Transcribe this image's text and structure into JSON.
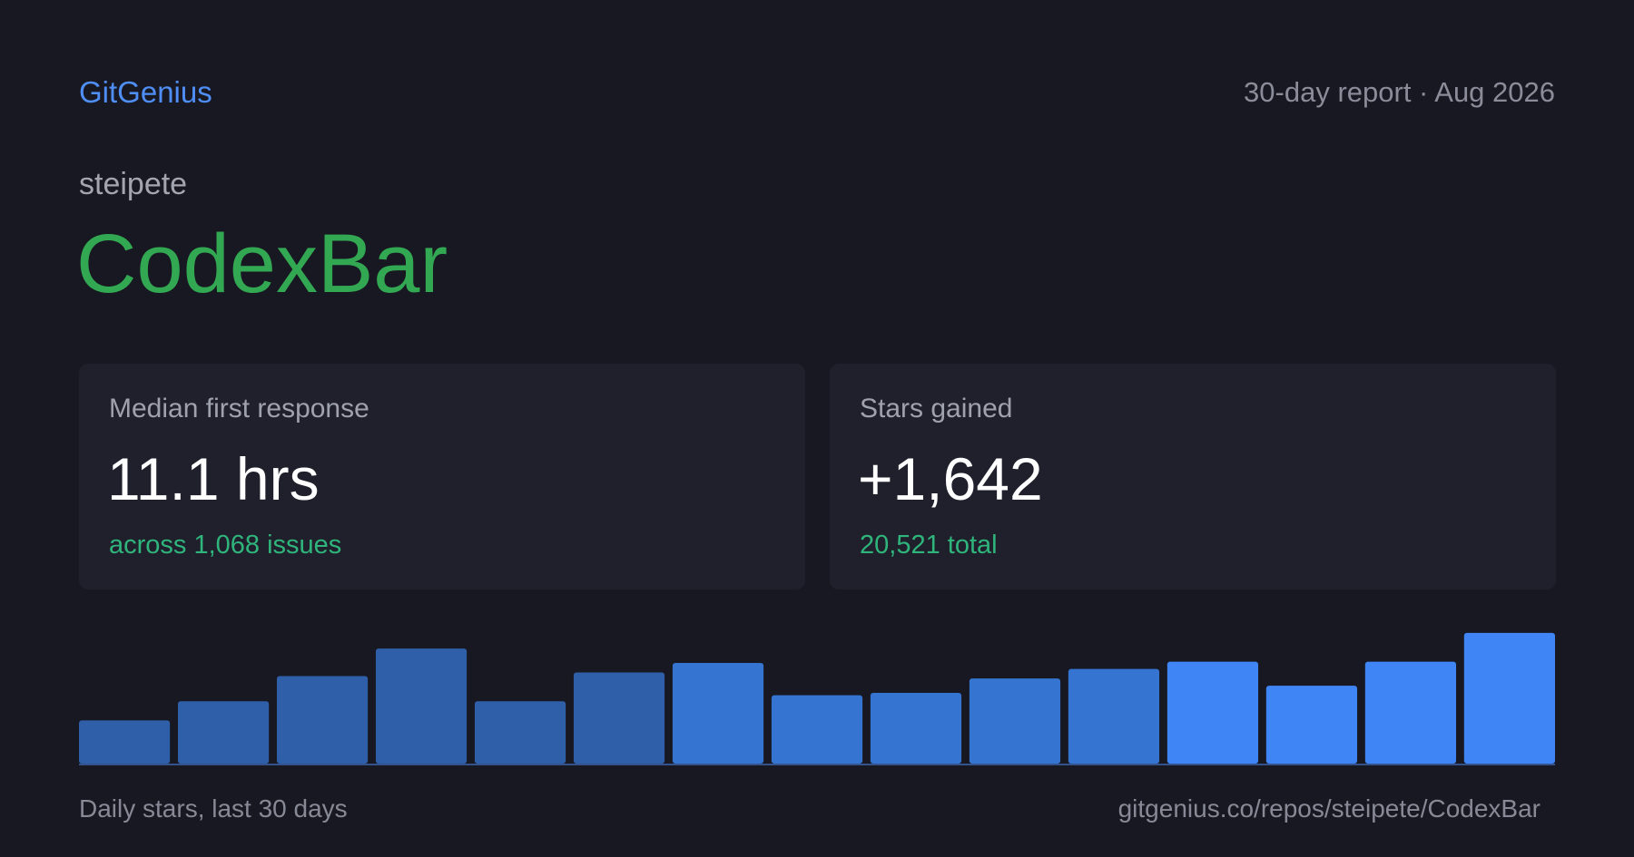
{
  "header": {
    "brand": "GitGenius",
    "report": "30-day report · Aug 2026"
  },
  "repo": {
    "owner": "steipete",
    "name": "CodexBar"
  },
  "metrics": {
    "response": {
      "label": "Median first response",
      "value": "11.1 hrs",
      "note": "across 1,068 issues"
    },
    "stars": {
      "label": "Stars gained",
      "value": "+1,642",
      "note": "20,521 total"
    }
  },
  "chart_data": {
    "type": "bar",
    "title": "Daily stars, last 30 days",
    "values": [
      36,
      52,
      73,
      96,
      52,
      76,
      84,
      57,
      59,
      71,
      79,
      85,
      65,
      85,
      109
    ],
    "ylim": [
      0,
      115
    ],
    "grid": false,
    "colors": [
      "#2f5fa8",
      "#2f5fa8",
      "#2f5fa8",
      "#2f5fa8",
      "#2f5fa8",
      "#2f5fa8",
      "#3575d1",
      "#3575d1",
      "#3575d1",
      "#3575d1",
      "#3575d1",
      "#3f85f5",
      "#3f85f5",
      "#3f85f5",
      "#3f85f5"
    ]
  },
  "footer": {
    "url": "gitgenius.co/repos/steipete/CodexBar"
  },
  "colors": {
    "background": "#171821",
    "card": "#1f202b",
    "brand": "#4f8ef5",
    "repo_name": "#33a853",
    "note": "#2fb57c"
  }
}
